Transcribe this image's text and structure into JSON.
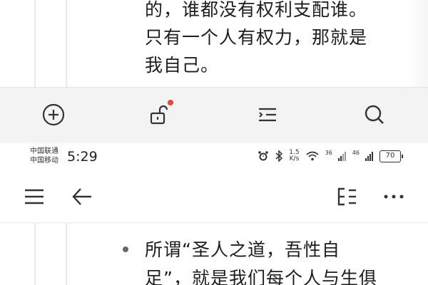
{
  "top_note": {
    "lines": [
      "的，谁都没有权利支配谁。",
      "只有一个人有权力，那就是",
      "我自己。"
    ]
  },
  "toolbar": {
    "buttons": [
      {
        "icon": "plus-circle-icon"
      },
      {
        "icon": "unlock-icon",
        "badge": true
      },
      {
        "icon": "outline-icon"
      },
      {
        "icon": "search-icon"
      }
    ],
    "badge_color": "#e8473c"
  },
  "statusbar": {
    "carrier1": "中国联通",
    "carrier2": "中国移动",
    "time": "5:29",
    "speed_value": "1.5",
    "speed_unit": "K/s",
    "network_a": "36",
    "network_b": "46",
    "battery": "70"
  },
  "navbar": {
    "icons": [
      "menu-icon",
      "back-arrow-icon",
      "toc-icon",
      "more-icon"
    ]
  },
  "bottom_note": {
    "lines": [
      "所谓“圣人之道，吾性自",
      "足”，就是我们每个人与生俱"
    ]
  }
}
